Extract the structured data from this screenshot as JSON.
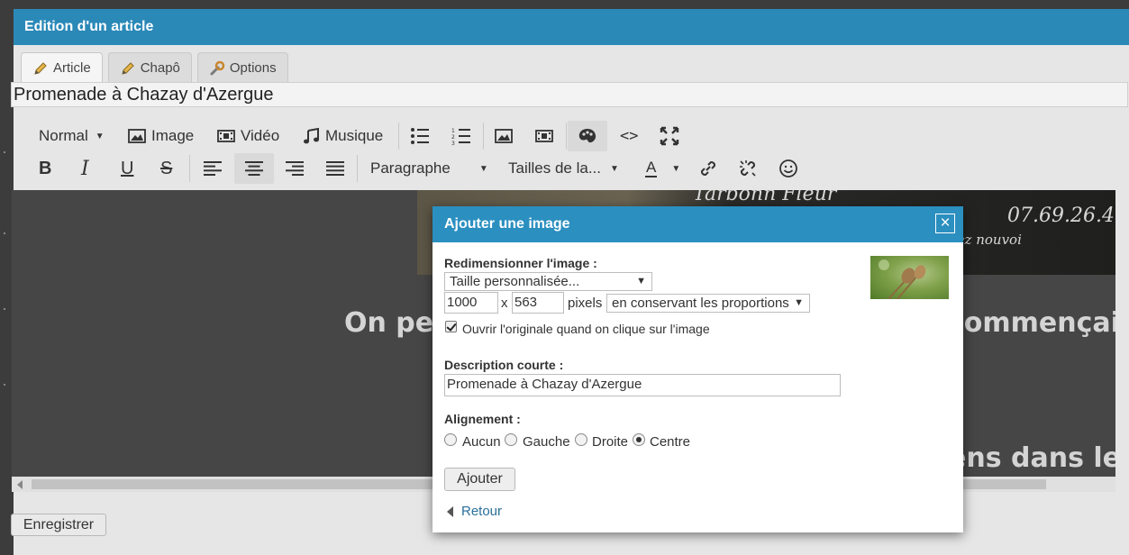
{
  "window": {
    "title": "Edition d'un article"
  },
  "tabs": [
    {
      "label": "Article",
      "icon": "pencil-icon",
      "active": true
    },
    {
      "label": "Chapô",
      "icon": "pencil-icon",
      "active": false
    },
    {
      "label": "Options",
      "icon": "wrench-icon",
      "active": false
    }
  ],
  "article": {
    "title_value": "Promenade à Chazay d'Azergue"
  },
  "toolbar": {
    "format_label": "Normal",
    "image_label": "Image",
    "video_label": "Vidéo",
    "music_label": "Musique",
    "paragraph_label": "Paragraphe",
    "sizes_label": "Tailles de la...",
    "font_color_label": "A"
  },
  "editor": {
    "line1_left": "On pe",
    "line1_right": "commençait l",
    "line2_right": "ens dans les",
    "chalk_number": "07.69.26.4",
    "chalk_word1": "Tarbonn Fleur",
    "chalk_word2": "elez nouvoi"
  },
  "footer": {
    "save_label": "Enregistrer"
  },
  "modal": {
    "title": "Ajouter une image",
    "close_label": "×",
    "resize_label": "Redimensionner l'image :",
    "resize_select": "Taille personnalisée...",
    "width_value": "1000",
    "x_label": "x",
    "height_value": "563",
    "pixels_label": "pixels",
    "proportions_select": "en conservant les proportions",
    "open_original_label": "Ouvrir l'originale quand on clique sur l'image",
    "open_original_checked": true,
    "description_label": "Description courte :",
    "description_value": "Promenade à Chazay d'Azergue",
    "alignment_label": "Alignement :",
    "alignment_options": [
      "Aucun",
      "Gauche",
      "Droite",
      "Centre"
    ],
    "alignment_selected": "Centre",
    "add_button": "Ajouter",
    "back_link": "Retour"
  }
}
